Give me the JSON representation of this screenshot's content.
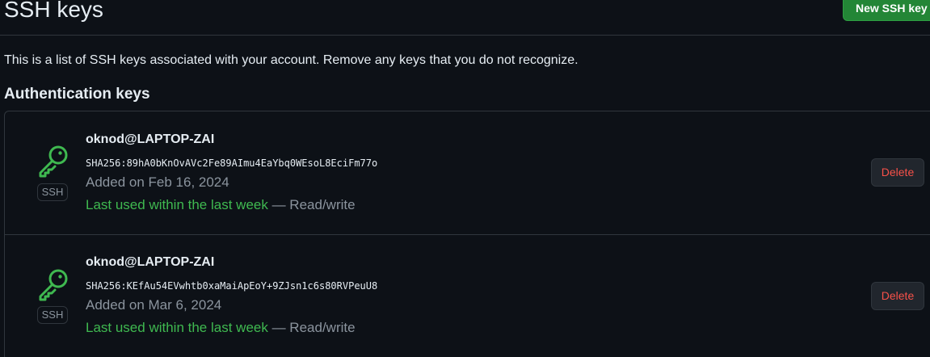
{
  "header": {
    "title": "SSH keys",
    "new_key_label": "New SSH key"
  },
  "intro_text": "This is a list of SSH keys associated with your account. Remove any keys that you do not recognize.",
  "section": {
    "heading": "Authentication keys"
  },
  "keys": [
    {
      "badge": "SSH",
      "name": "oknod@LAPTOP-ZAI",
      "fingerprint": "SHA256:89hA0bKnOvAVc2Fe89AImu4EaYbq0WEsoL8EciFm77o",
      "added": "Added on Feb 16, 2024",
      "last_used": "Last used within the last week",
      "access": " — Read/write",
      "delete_label": "Delete"
    },
    {
      "badge": "SSH",
      "name": "oknod@LAPTOP-ZAI",
      "fingerprint": "SHA256:KEfAu54EVwhtb0xaMaiApEoY+9ZJsn1c6s80RVPeuU8",
      "added": "Added on Mar 6, 2024",
      "last_used": "Last used within the last week",
      "access": " — Read/write",
      "delete_label": "Delete"
    }
  ],
  "icons": {
    "key_icon": "key-icon"
  },
  "colors": {
    "background": "#0d1117",
    "accent_green": "#3fb950",
    "button_green": "#238636",
    "danger_red": "#f85149",
    "muted": "#8b949e",
    "border": "#30363d"
  }
}
